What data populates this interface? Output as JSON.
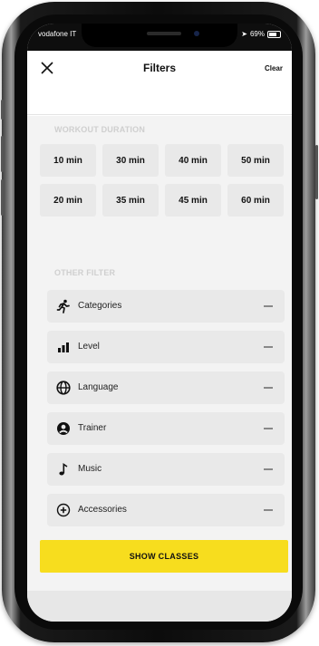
{
  "status_bar": {
    "carrier": "vodafone IT",
    "battery": "69%"
  },
  "header": {
    "title": "Filters",
    "clear_label": "Clear"
  },
  "workout_duration": {
    "label": "WORKOUT DURATION",
    "options": [
      "10 min",
      "30 min",
      "40 min",
      "50 min",
      "20 min",
      "35 min",
      "45 min",
      "60 min"
    ]
  },
  "other_filter": {
    "label": "OTHER FILTER",
    "items": [
      {
        "label": "Categories",
        "icon": "running-person-icon"
      },
      {
        "label": "Level",
        "icon": "level-bars-icon"
      },
      {
        "label": "Language",
        "icon": "globe-icon"
      },
      {
        "label": "Trainer",
        "icon": "user-circle-icon"
      },
      {
        "label": "Music",
        "icon": "music-note-icon"
      },
      {
        "label": "Accessories",
        "icon": "plus-circle-icon"
      }
    ]
  },
  "footer": {
    "show_classes_label": "SHOW CLASSES"
  },
  "colors": {
    "accent": "#f7dd1e",
    "chip_bg": "#e9e9e9",
    "screen_bg": "#f3f3f3"
  }
}
